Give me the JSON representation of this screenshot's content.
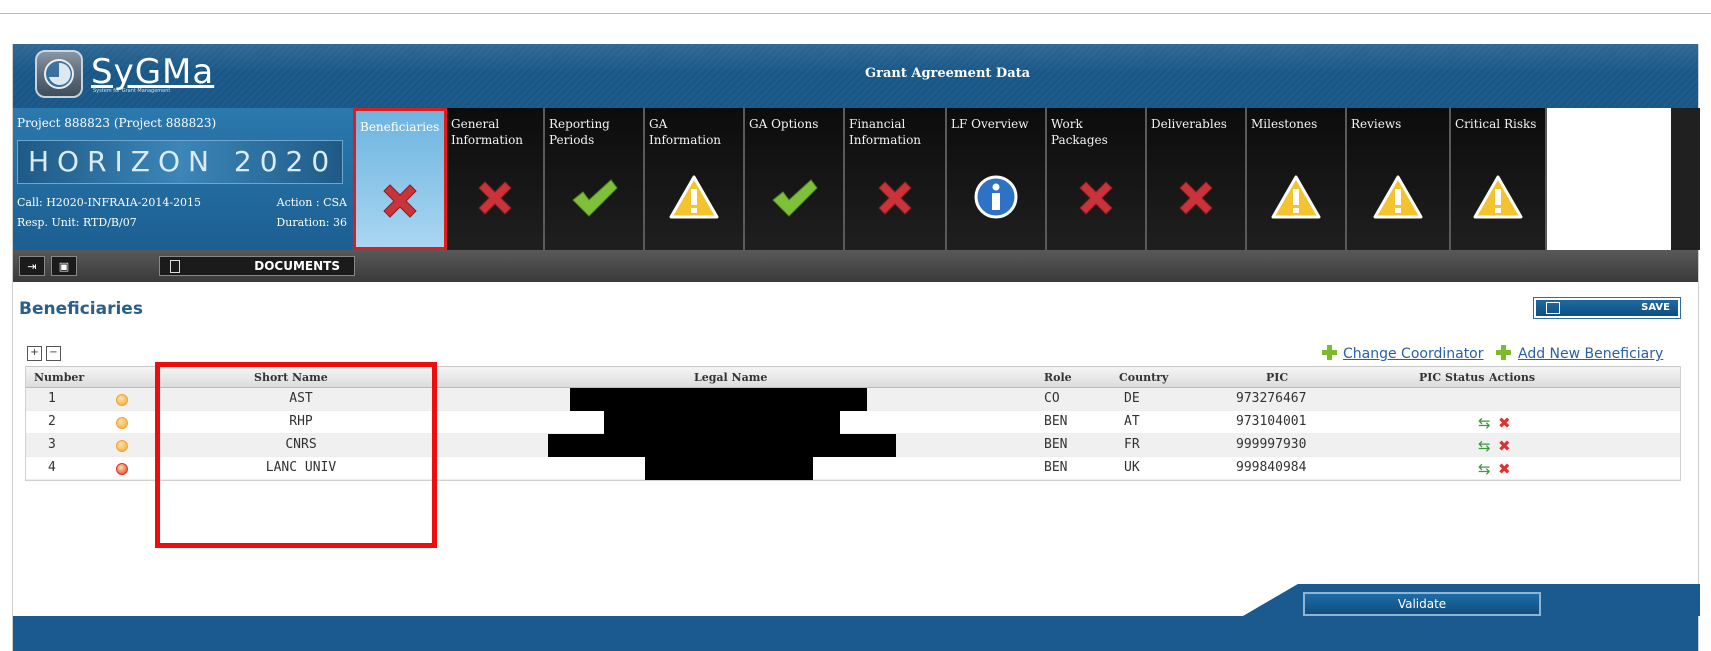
{
  "header": {
    "app_name": "SyGMa",
    "app_subtitle": "System for Grant Management",
    "title": "Grant Agreement Data"
  },
  "project": {
    "title": "Project 888823 (Project 888823)",
    "program": "HORIZON 2020",
    "call": "Call: H2020-INFRAIA-2014-2015",
    "action": "Action : CSA",
    "resp_unit": "Resp. Unit: RTD/B/07",
    "duration": "Duration: 36"
  },
  "tabs": [
    {
      "label": "Beneficiaries",
      "status": "error",
      "active": true
    },
    {
      "label": "General Information",
      "status": "error"
    },
    {
      "label": "Reporting Periods",
      "status": "ok"
    },
    {
      "label": "GA Information",
      "status": "warning"
    },
    {
      "label": "GA Options",
      "status": "ok"
    },
    {
      "label": "Financial Information",
      "status": "error"
    },
    {
      "label": "LF Overview",
      "status": "info"
    },
    {
      "label": "Work Packages",
      "status": "error"
    },
    {
      "label": "Deliverables",
      "status": "error"
    },
    {
      "label": "Milestones",
      "status": "warning"
    },
    {
      "label": "Reviews",
      "status": "warning"
    },
    {
      "label": "Critical Risks",
      "status": "warning"
    }
  ],
  "toolbar": {
    "documents_label": "DOCUMENTS"
  },
  "section": {
    "title": "Beneficiaries",
    "save_label": "SAVE"
  },
  "links": {
    "change_coordinator": "Change Coordinator",
    "add_beneficiary": "Add New Beneficiary"
  },
  "table": {
    "columns": [
      "Number",
      "Short Name",
      "Legal Name",
      "Role",
      "Country",
      "PIC",
      "PIC Status",
      "Actions"
    ],
    "rows": [
      {
        "number": "1",
        "status": "orange",
        "short_name": "AST",
        "role": "CO",
        "country": "DE",
        "pic": "973276467",
        "actions": false
      },
      {
        "number": "2",
        "status": "orange",
        "short_name": "RHP",
        "role": "BEN",
        "country": "AT",
        "pic": "973104001",
        "actions": true
      },
      {
        "number": "3",
        "status": "orange",
        "short_name": "CNRS",
        "role": "BEN",
        "country": "FR",
        "pic": "999997930",
        "actions": true
      },
      {
        "number": "4",
        "status": "red",
        "short_name": "LANC UNIV",
        "role": "BEN",
        "country": "UK",
        "pic": "999840984",
        "actions": true
      }
    ]
  },
  "footer": {
    "validate_label": "Validate"
  },
  "colors": {
    "header_blue": "#1d5d8d",
    "highlight_red": "#ee0d0d",
    "link_blue": "#2a5fa8"
  }
}
